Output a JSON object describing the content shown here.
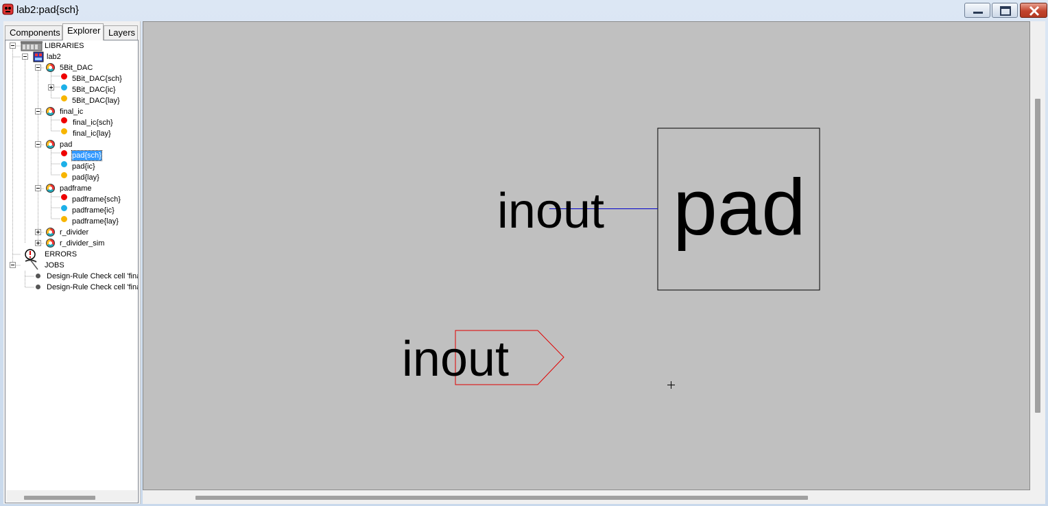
{
  "window": {
    "title": "lab2:pad{sch}"
  },
  "tabs": [
    {
      "label": "Components",
      "active": false
    },
    {
      "label": "Explorer",
      "active": true
    },
    {
      "label": "Layers",
      "active": false
    }
  ],
  "tree": {
    "libraries": "LIBRARIES",
    "lab2": "lab2",
    "cells": [
      {
        "name": "5Bit_DAC",
        "views": [
          "5Bit_DAC{sch}",
          "5Bit_DAC{ic}",
          "5Bit_DAC{lay}"
        ]
      },
      {
        "name": "final_ic",
        "views": [
          "final_ic{sch}",
          "final_ic{lay}"
        ]
      },
      {
        "name": "pad",
        "views": [
          "pad{sch}",
          "pad{ic}",
          "pad{lay}"
        ]
      },
      {
        "name": "padframe",
        "views": [
          "padframe{sch}",
          "padframe{ic}",
          "padframe{lay}"
        ]
      },
      {
        "name": "r_divider",
        "views": []
      },
      {
        "name": "r_divider_sim",
        "views": []
      }
    ],
    "selected": "pad{sch}",
    "errors": "ERRORS",
    "jobs": "JOBS",
    "job_items": [
      "Design-Rule Check cell 'fina",
      "Design-Rule Check cell 'fina"
    ]
  },
  "schematic": {
    "export_label_top": "inout",
    "pad_label": "pad",
    "export_label_bottom": "inout"
  },
  "colors": {
    "sch_dot": "#ee0000",
    "ic_dot": "#1cb0e8",
    "lay_dot": "#f7b500",
    "wire": "#0000cc",
    "export_outline": "#e00000"
  }
}
